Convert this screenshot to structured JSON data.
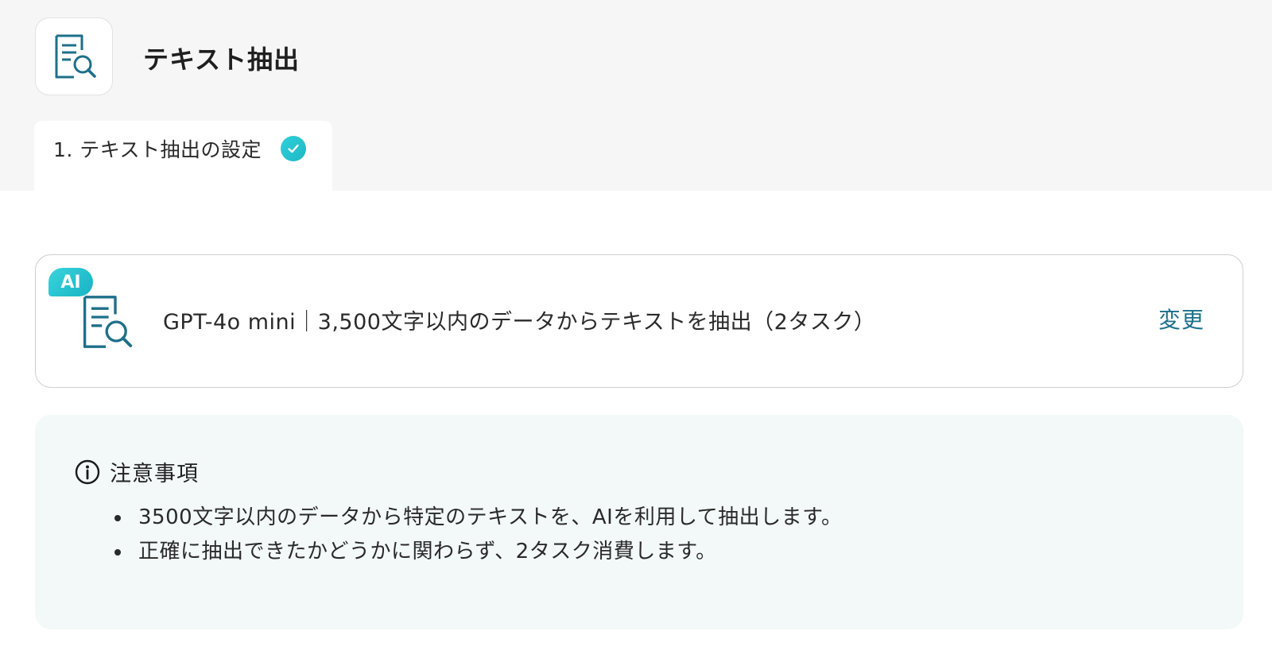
{
  "header": {
    "title": "テキスト抽出",
    "icon": "document-search-icon"
  },
  "tabs": [
    {
      "label": "1. テキスト抽出の設定",
      "completed": true
    }
  ],
  "action_card": {
    "badge": "AI",
    "icon": "document-search-icon",
    "description": "GPT-4o mini｜3,500文字以内のデータからテキストを抽出（2タスク）",
    "change_label": "変更"
  },
  "notice": {
    "icon": "info-icon",
    "title": "注意事項",
    "items": [
      "3500文字以内のデータから特定のテキストを、AIを利用して抽出します。",
      "正確に抽出できたかどうかに関わらず、2タスク消費します。"
    ]
  },
  "colors": {
    "accent": "#1e6f8a",
    "badge": "#1fbac8",
    "notice_bg": "#f3f8f8",
    "header_bg": "#f6f6f6"
  }
}
